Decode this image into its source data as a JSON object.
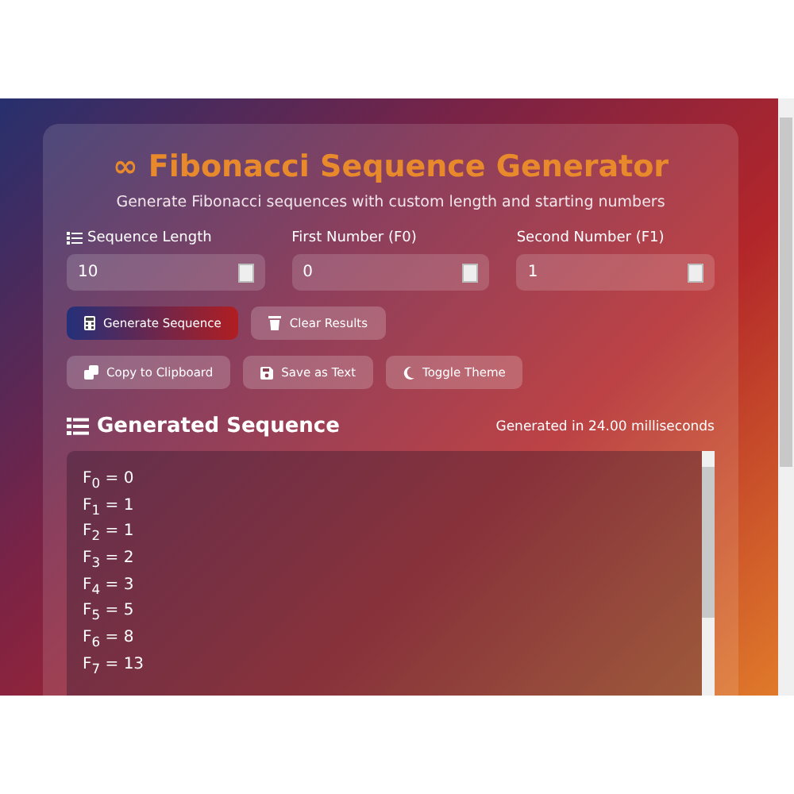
{
  "header": {
    "icon": "∞",
    "title": "Fibonacci Sequence Generator",
    "subtitle": "Generate Fibonacci sequences with custom length and starting numbers"
  },
  "fields": [
    {
      "label": "Sequence Length",
      "value": "10"
    },
    {
      "label": "First Number (F0)",
      "value": "0"
    },
    {
      "label": "Second Number (F1)",
      "value": "1"
    }
  ],
  "buttons": [
    [
      {
        "label": "Generate Sequence",
        "kind": "primary"
      },
      {
        "label": "Clear Results",
        "kind": "secondary"
      }
    ],
    [
      {
        "label": "Copy to Clipboard",
        "kind": "secondary"
      },
      {
        "label": "Save as Text",
        "kind": "secondary"
      },
      {
        "label": "Toggle Theme",
        "kind": "secondary"
      }
    ]
  ],
  "results": {
    "title": "Generated Sequence",
    "timing": "Generated in 24.00 milliseconds",
    "sequence": [
      "F$_{0}$ = 0",
      "F$_{1}$ = 1",
      "F$_{2}$ = 1",
      "F$_{3}$ = 2",
      "F$_{4}$ = 3",
      "F$_{5}$ = 5",
      "F$_{6}$ = 8",
      "F$_{7}$ = 13"
    ]
  }
}
